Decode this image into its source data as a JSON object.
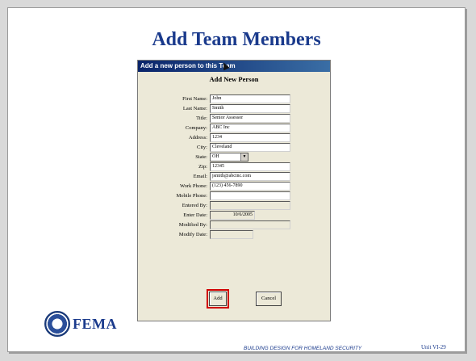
{
  "slide": {
    "title": "Add Team Members",
    "footer": "BUILDING DESIGN FOR HOMELAND SECURITY",
    "unit": "Unit VI-29",
    "logo_text": "FEMA"
  },
  "dialog": {
    "title": "Add a new person to this Team",
    "heading": "Add New Person",
    "fields": [
      {
        "label": "First Name:",
        "value": "John"
      },
      {
        "label": "Last Name:",
        "value": "Smith"
      },
      {
        "label": "Title:",
        "value": "Senior Assessor"
      },
      {
        "label": "Company:",
        "value": "ABC Inc"
      },
      {
        "label": "Address:",
        "value": "1234"
      },
      {
        "label": "City:",
        "value": "Cleveland"
      },
      {
        "label": "State:",
        "value": "OH"
      },
      {
        "label": "Zip:",
        "value": "12345"
      },
      {
        "label": "Email:",
        "value": "jsmith@abcinc.com"
      },
      {
        "label": "Work Phone:",
        "value": "(123) 456-7890"
      },
      {
        "label": "Mobile Phone:",
        "value": ""
      },
      {
        "label": "Entered By:",
        "value": ""
      },
      {
        "label": "Enter Date:",
        "value": "10/6/2005"
      },
      {
        "label": "Modified By:",
        "value": ""
      },
      {
        "label": "Modify Date:",
        "value": ""
      }
    ],
    "buttons": {
      "add": "Add",
      "cancel": "Cancel"
    }
  },
  "icons": {
    "seal": "dhs-seal-icon",
    "state_dropdown": "chevron-down-icon"
  },
  "colors": {
    "title_blue": "#1a3a8c",
    "highlight_red": "#d00000",
    "dialog_bg": "#ece9d8"
  }
}
